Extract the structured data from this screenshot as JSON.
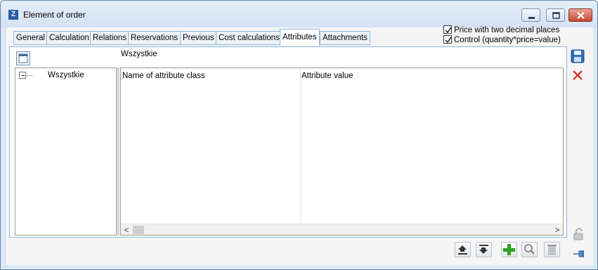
{
  "window": {
    "title": "Element of order",
    "app_glyph": "Z"
  },
  "tabs": [
    {
      "label": "General"
    },
    {
      "label": "Calculation"
    },
    {
      "label": "Relations"
    },
    {
      "label": "Reservations"
    },
    {
      "label": "Previous"
    },
    {
      "label": "Cost calculations"
    },
    {
      "label": "Attributes",
      "active": true
    },
    {
      "label": "Attachments"
    }
  ],
  "options": {
    "price_two_decimals": {
      "label": "Price with two decimal places",
      "checked": true
    },
    "control_qty_price": {
      "label": "Control (quantity*price=value)",
      "checked": true
    }
  },
  "breadcrumb": "Wszystkie",
  "tree": {
    "root_label": "Wszystkie"
  },
  "grid": {
    "columns": [
      "Name of attribute class",
      "Attribute value"
    ],
    "rows": []
  },
  "scroll_arrows": {
    "left": "<",
    "right": ">"
  },
  "icons": {
    "save": "save-disk-icon",
    "close": "close-x-icon",
    "unlock": "padlock-icon",
    "pin": "pin-icon",
    "move_up": "move-up-icon",
    "move_down": "move-down-icon",
    "add": "add-plus-icon",
    "find": "magnifier-icon",
    "delete": "trash-icon"
  },
  "colors": {
    "accent_border": "#8cb6dc",
    "save_blue": "#2f6fb7",
    "close_red": "#d9382c",
    "add_green": "#2ea022"
  }
}
